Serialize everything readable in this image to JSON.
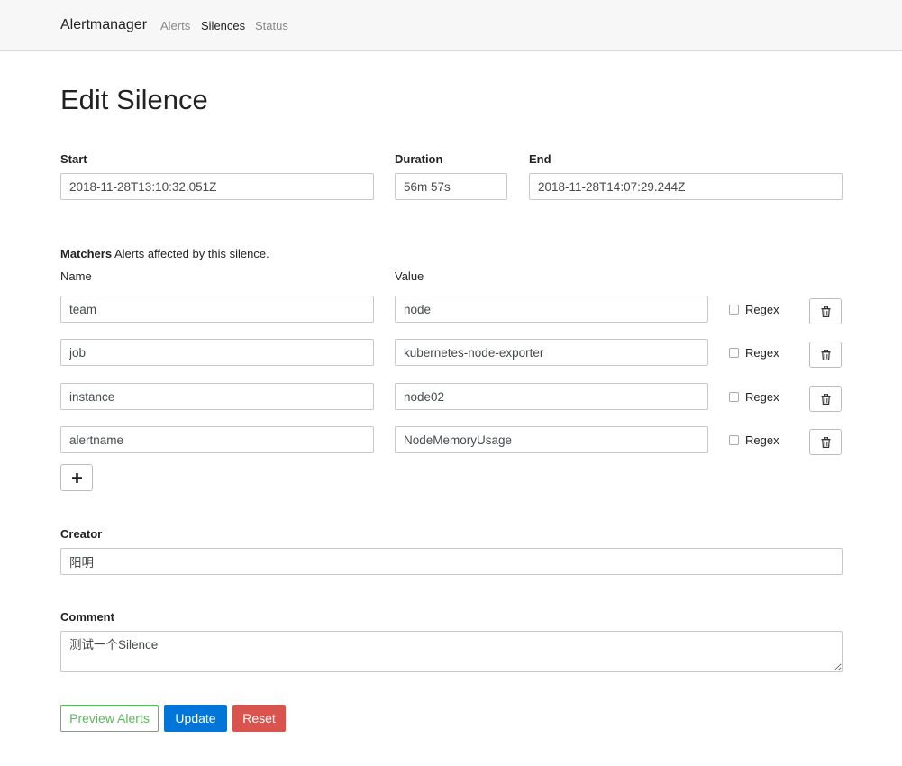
{
  "navbar": {
    "brand": "Alertmanager",
    "links": [
      {
        "label": "Alerts",
        "active": false
      },
      {
        "label": "Silences",
        "active": true
      },
      {
        "label": "Status",
        "active": false
      }
    ]
  },
  "page": {
    "title": "Edit Silence"
  },
  "timing": {
    "start_label": "Start",
    "start_value": "2018-11-28T13:10:32.051Z",
    "duration_label": "Duration",
    "duration_value": "56m 57s",
    "end_label": "End",
    "end_value": "2018-11-28T14:07:29.244Z"
  },
  "matchers": {
    "title": "Matchers",
    "subtitle": "Alerts affected by this silence.",
    "name_header": "Name",
    "value_header": "Value",
    "regex_label": "Regex",
    "rows": [
      {
        "name": "team",
        "value": "node",
        "regex": false
      },
      {
        "name": "job",
        "value": "kubernetes-node-exporter",
        "regex": false
      },
      {
        "name": "instance",
        "value": "node02",
        "regex": false
      },
      {
        "name": "alertname",
        "value": "NodeMemoryUsage",
        "regex": false
      }
    ]
  },
  "creator": {
    "label": "Creator",
    "value": "阳明"
  },
  "comment": {
    "label": "Comment",
    "value": "测试一个Silence"
  },
  "actions": {
    "preview_label": "Preview Alerts",
    "update_label": "Update",
    "reset_label": "Reset"
  },
  "colors": {
    "primary": "#0275d8",
    "danger": "#d9534f",
    "success": "#5cb85c",
    "navbar_bg": "#f7f7f7"
  },
  "icons": {
    "delete": "trash-icon",
    "add": "plus-icon",
    "regex_toggle": "checkbox"
  }
}
